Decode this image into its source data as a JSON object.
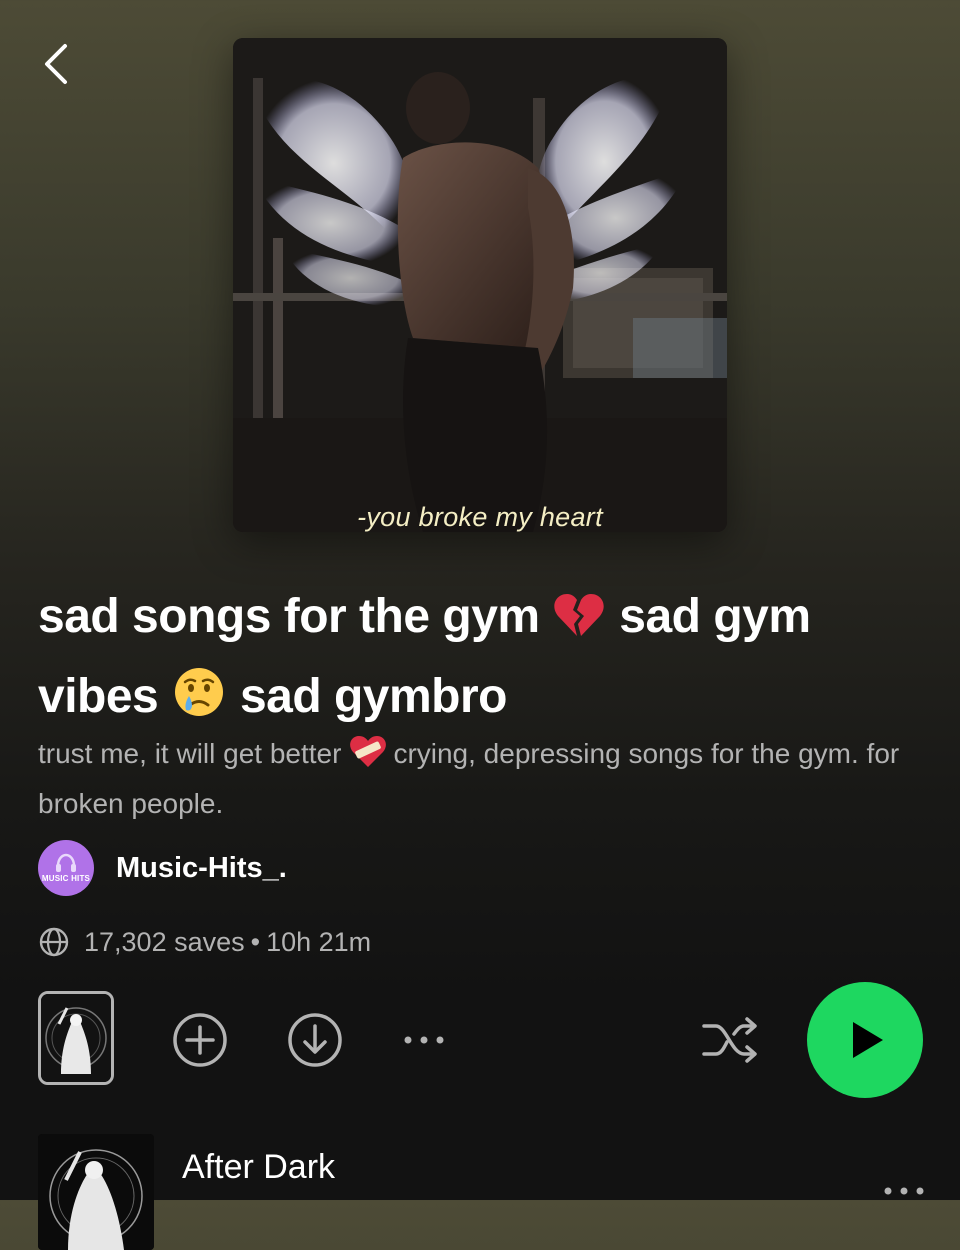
{
  "header": {
    "back_icon": "chevron-left-icon"
  },
  "cover": {
    "caption": "-you broke my heart"
  },
  "playlist": {
    "title_part1": "sad songs for the gym",
    "title_part2": "sad gym",
    "title_part3": "vibes",
    "title_part4": "sad gymbro",
    "title_emojis": [
      "broken-heart-emoji",
      "crying-face-emoji"
    ],
    "description_part1": "trust me, it will get better",
    "description_part2": "crying, depressing songs for the gym. for broken people.",
    "description_emoji": "mending-heart-emoji"
  },
  "owner": {
    "name": "Music-Hits_.",
    "avatar_text": "MUSIC HITS",
    "avatar_color": "#b072e8"
  },
  "meta": {
    "globe_icon": "globe-icon",
    "saves": "17,302 saves",
    "separator": "•",
    "duration": "10h 21m"
  },
  "actions": {
    "add_icon": "plus-circle-icon",
    "download_icon": "download-circle-icon",
    "more_icon": "more-horizontal-icon",
    "shuffle_icon": "shuffle-icon",
    "play_icon": "play-icon",
    "play_color": "#1ed760"
  },
  "tracks": [
    {
      "title": "After Dark",
      "more_icon": "more-horizontal-icon"
    }
  ]
}
